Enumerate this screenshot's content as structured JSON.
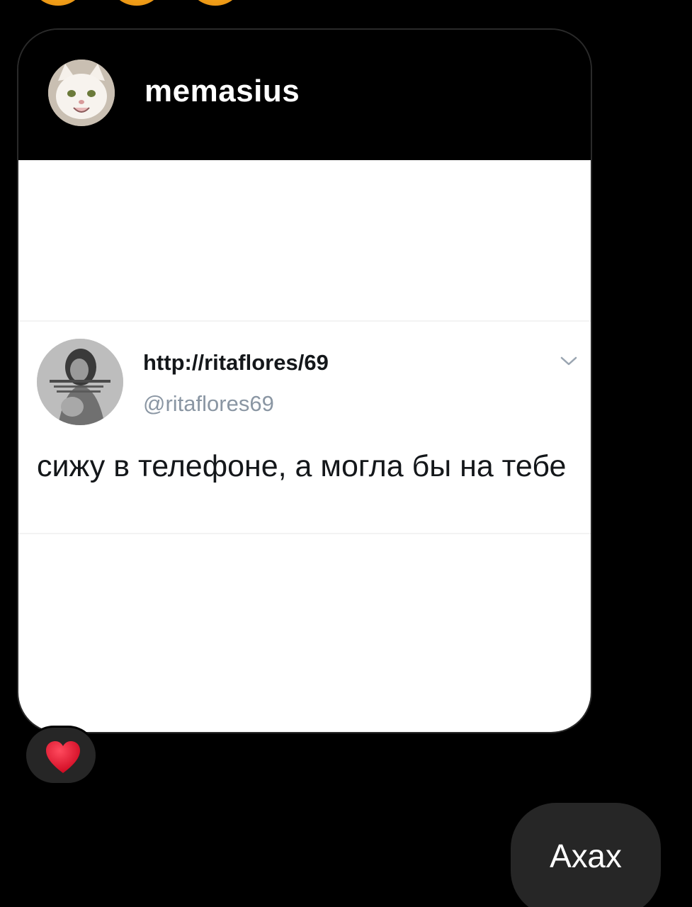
{
  "colors": {
    "background": "#000000",
    "bubble": "#262626",
    "heart": "#e0102a",
    "tweet_text": "#14171a",
    "tweet_handle": "#8a96a3",
    "emoji": "#f4a21a"
  },
  "top_reactions": {
    "icons": [
      "emoji-icon",
      "emoji-icon",
      "emoji-icon"
    ]
  },
  "shared_post": {
    "username": "memasius",
    "avatar_icon": "cat-avatar-icon",
    "tweet": {
      "display_name": "http://ritaflores/69",
      "handle": "@ritaflores69",
      "text": "сижу в телефоне, а могла бы на тебе",
      "avatar_icon": "profile-photo-icon",
      "menu_icon": "chevron-down-icon"
    }
  },
  "reaction": {
    "icon": "heart-icon"
  },
  "outgoing_message": {
    "text": "Ахах"
  }
}
